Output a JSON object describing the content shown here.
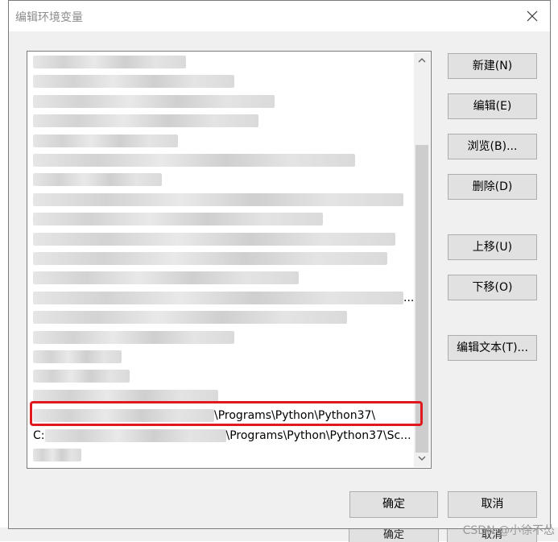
{
  "dialog": {
    "title": "编辑环境变量",
    "close_icon": "close-icon"
  },
  "path_list": {
    "visible_entries": [
      {
        "prefix": "",
        "text": ""
      },
      {
        "prefix": "",
        "text": ""
      },
      {
        "prefix": "",
        "text": ""
      },
      {
        "prefix": "",
        "text": ""
      },
      {
        "prefix": "",
        "text": ""
      },
      {
        "prefix": "",
        "text": ""
      },
      {
        "prefix": "",
        "text": ""
      },
      {
        "prefix": "",
        "text": ""
      },
      {
        "prefix": "",
        "text": ""
      },
      {
        "prefix": "",
        "text": ""
      },
      {
        "prefix": "",
        "text": ""
      },
      {
        "prefix": "",
        "text": ""
      },
      {
        "prefix": "",
        "text": "..."
      },
      {
        "prefix": "",
        "text": ""
      },
      {
        "prefix": "",
        "text": ""
      },
      {
        "prefix": "",
        "text": ""
      },
      {
        "prefix": "",
        "text": ""
      },
      {
        "prefix": "",
        "text": ""
      },
      {
        "prefix": "",
        "text": "\\Programs\\Python\\Python37\\"
      },
      {
        "prefix": "C:",
        "text": "\\Programs\\Python\\Python37\\Sc..."
      },
      {
        "prefix": "",
        "text": ""
      },
      {
        "prefix": "",
        "text": ""
      }
    ]
  },
  "buttons": {
    "new": "新建(N)",
    "edit": "编辑(E)",
    "browse": "浏览(B)...",
    "delete": "删除(D)",
    "move_up": "上移(U)",
    "move_down": "下移(O)",
    "edit_text": "编辑文本(T)...",
    "ok": "确定",
    "cancel": "取消"
  },
  "background_window": {
    "ok": "确定",
    "cancel": "取消"
  },
  "watermark": "CSDN @小徐不怂"
}
